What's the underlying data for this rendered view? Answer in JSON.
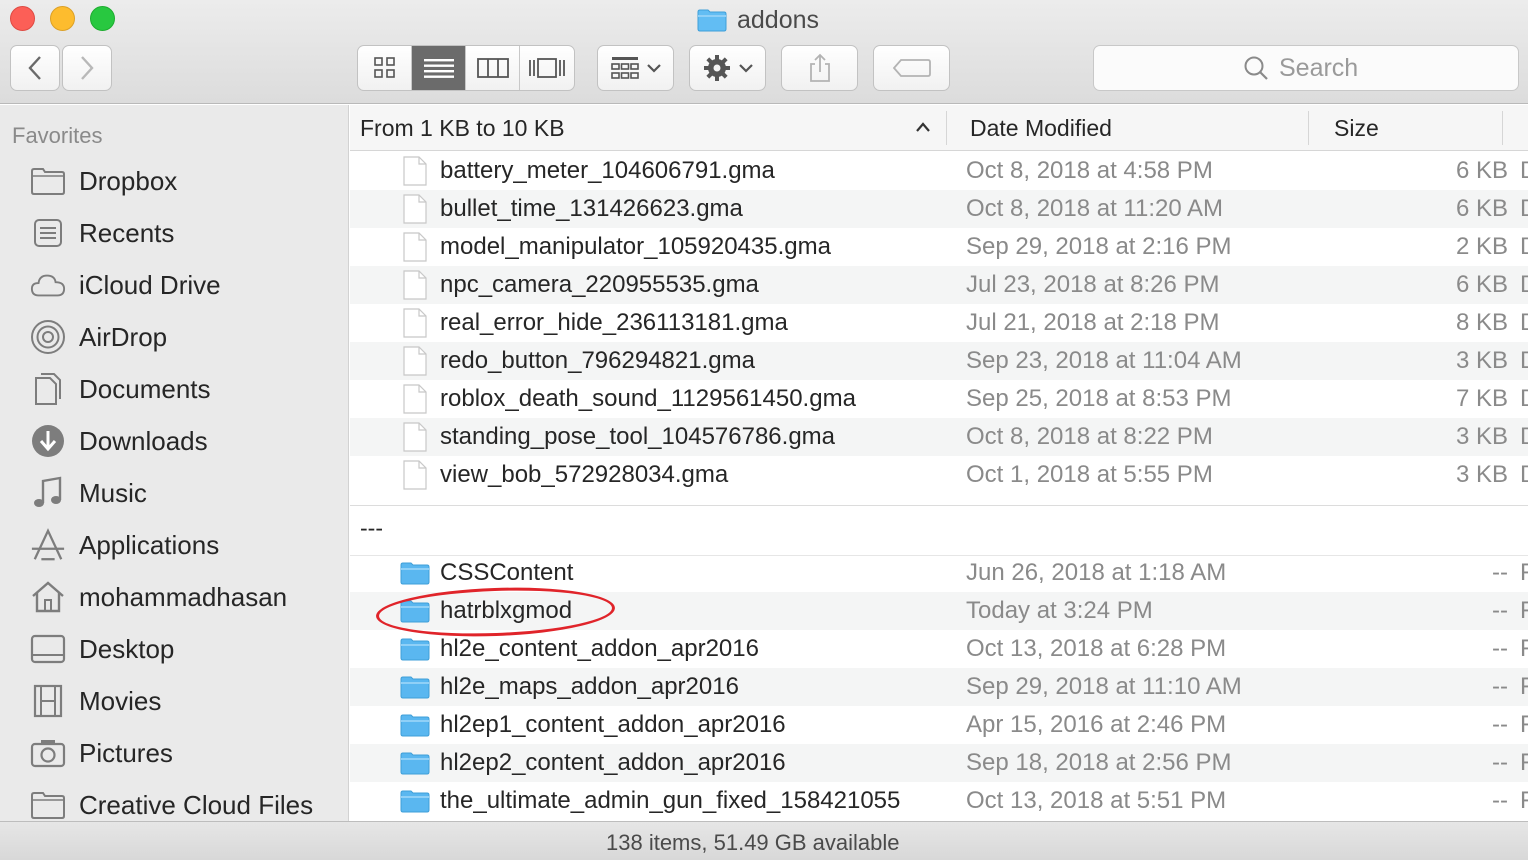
{
  "window": {
    "title": "addons"
  },
  "toolbar": {
    "back_icon": "chevron-left-icon",
    "forward_icon": "chevron-right-icon",
    "view_modes": [
      "icon-view-icon",
      "list-view-icon",
      "column-view-icon",
      "cover-flow-icon"
    ],
    "active_view": "list",
    "group_icon": "group-by-icon",
    "action_icon": "gear-icon",
    "share_icon": "share-icon",
    "tags_icon": "tag-icon",
    "search_placeholder": "Search"
  },
  "sidebar": {
    "heading": "Favorites",
    "items": [
      {
        "label": "Dropbox",
        "icon": "folder-icon"
      },
      {
        "label": "Recents",
        "icon": "recents-icon"
      },
      {
        "label": "iCloud Drive",
        "icon": "cloud-icon"
      },
      {
        "label": "AirDrop",
        "icon": "airdrop-icon"
      },
      {
        "label": "Documents",
        "icon": "documents-icon"
      },
      {
        "label": "Downloads",
        "icon": "downloads-icon"
      },
      {
        "label": "Music",
        "icon": "music-icon"
      },
      {
        "label": "Applications",
        "icon": "applications-icon"
      },
      {
        "label": "mohammadhasan",
        "icon": "home-icon"
      },
      {
        "label": "Desktop",
        "icon": "desktop-icon"
      },
      {
        "label": "Movies",
        "icon": "movies-icon"
      },
      {
        "label": "Pictures",
        "icon": "pictures-icon"
      },
      {
        "label": "Creative Cloud Files",
        "icon": "folder-icon"
      }
    ]
  },
  "columns": {
    "name": "From 1 KB to 10 KB",
    "date": "Date Modified",
    "size": "Size",
    "sort_icon": "chevron-up-icon"
  },
  "files": [
    {
      "name": "battery_meter_104606791.gma",
      "date": "Oct 8, 2018 at 4:58 PM",
      "size": "6 KB",
      "kind": "D"
    },
    {
      "name": "bullet_time_131426623.gma",
      "date": "Oct 8, 2018 at 11:20 AM",
      "size": "6 KB",
      "kind": "D"
    },
    {
      "name": "model_manipulator_105920435.gma",
      "date": "Sep 29, 2018 at 2:16 PM",
      "size": "2 KB",
      "kind": "D"
    },
    {
      "name": "npc_camera_220955535.gma",
      "date": "Jul 23, 2018 at 8:26 PM",
      "size": "6 KB",
      "kind": "D"
    },
    {
      "name": "real_error_hide_236113181.gma",
      "date": "Jul 21, 2018 at 2:18 PM",
      "size": "8 KB",
      "kind": "D"
    },
    {
      "name": "redo_button_796294821.gma",
      "date": "Sep 23, 2018 at 11:04 AM",
      "size": "3 KB",
      "kind": "D"
    },
    {
      "name": "roblox_death_sound_1129561450.gma",
      "date": "Sep 25, 2018 at 8:53 PM",
      "size": "7 KB",
      "kind": "D"
    },
    {
      "name": "standing_pose_tool_104576786.gma",
      "date": "Oct 8, 2018 at 8:22 PM",
      "size": "3 KB",
      "kind": "D"
    },
    {
      "name": "view_bob_572928034.gma",
      "date": "Oct 1, 2018 at 5:55 PM",
      "size": "3 KB",
      "kind": "D"
    }
  ],
  "group2_label": "---",
  "folders": [
    {
      "name": "CSSContent",
      "date": "Jun 26, 2018 at 1:18 AM",
      "size": "--",
      "kind": "F"
    },
    {
      "name": "hatrblxgmod",
      "date": "Today at 3:24 PM",
      "size": "--",
      "kind": "F"
    },
    {
      "name": "hl2e_content_addon_apr2016",
      "date": "Oct 13, 2018 at 6:28 PM",
      "size": "--",
      "kind": "F"
    },
    {
      "name": "hl2e_maps_addon_apr2016",
      "date": "Sep 29, 2018 at 11:10 AM",
      "size": "--",
      "kind": "F"
    },
    {
      "name": "hl2ep1_content_addon_apr2016",
      "date": "Apr 15, 2016 at 2:46 PM",
      "size": "--",
      "kind": "F"
    },
    {
      "name": "hl2ep2_content_addon_apr2016",
      "date": "Sep 18, 2018 at 2:56 PM",
      "size": "--",
      "kind": "F"
    },
    {
      "name": "the_ultimate_admin_gun_fixed_158421055",
      "date": "Oct 13, 2018 at 5:51 PM",
      "size": "--",
      "kind": "F"
    }
  ],
  "annotation": {
    "circled_item": "hatrblxgmod",
    "color": "#e0242a"
  },
  "status": {
    "text": "138 items, 51.49 GB available"
  },
  "colors": {
    "folder": "#5ab7f0",
    "sidebar_bg": "#eaeaea",
    "active_view": "#6b6b6b"
  }
}
